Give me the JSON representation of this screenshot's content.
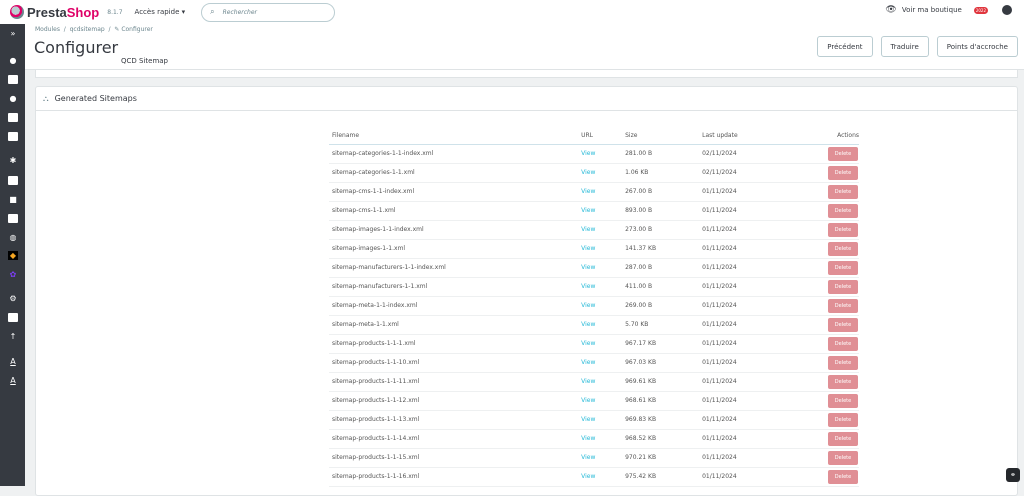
{
  "topbar": {
    "brand_a": "Presta",
    "brand_b": "Shop",
    "version": "8.1.7",
    "quick_access": "Accès rapide ▾",
    "search_placeholder": "Rechercher",
    "view_shop": "Voir ma boutique",
    "notif_badge": "2022"
  },
  "breadcrumb": {
    "items": [
      "Modules",
      "qcdsitemap",
      "Configurer"
    ]
  },
  "header": {
    "title": "Configurer",
    "subtitle": "QCD Sitemap",
    "buttons": [
      "Précédent",
      "Traduire",
      "Points d'accroche"
    ]
  },
  "card": {
    "title": "Generated Sitemaps"
  },
  "table": {
    "headers": [
      "Filename",
      "URL",
      "Size",
      "Last update",
      "Actions"
    ],
    "view_label": "View",
    "delete_label": "Delete",
    "rows": [
      [
        "sitemap-categories-1-1-index.xml",
        "281.00 B",
        "02/11/2024"
      ],
      [
        "sitemap-categories-1-1.xml",
        "1.06 KB",
        "02/11/2024"
      ],
      [
        "sitemap-cms-1-1-index.xml",
        "267.00 B",
        "01/11/2024"
      ],
      [
        "sitemap-cms-1-1.xml",
        "893.00 B",
        "01/11/2024"
      ],
      [
        "sitemap-images-1-1-index.xml",
        "273.00 B",
        "01/11/2024"
      ],
      [
        "sitemap-images-1-1.xml",
        "141.37 KB",
        "01/11/2024"
      ],
      [
        "sitemap-manufacturers-1-1-index.xml",
        "287.00 B",
        "01/11/2024"
      ],
      [
        "sitemap-manufacturers-1-1.xml",
        "411.00 B",
        "01/11/2024"
      ],
      [
        "sitemap-meta-1-1-index.xml",
        "269.00 B",
        "01/11/2024"
      ],
      [
        "sitemap-meta-1-1.xml",
        "5.70 KB",
        "01/11/2024"
      ],
      [
        "sitemap-products-1-1-1.xml",
        "967.17 KB",
        "01/11/2024"
      ],
      [
        "sitemap-products-1-1-10.xml",
        "967.03 KB",
        "01/11/2024"
      ],
      [
        "sitemap-products-1-1-11.xml",
        "969.61 KB",
        "01/11/2024"
      ],
      [
        "sitemap-products-1-1-12.xml",
        "968.61 KB",
        "01/11/2024"
      ],
      [
        "sitemap-products-1-1-13.xml",
        "969.83 KB",
        "01/11/2024"
      ],
      [
        "sitemap-products-1-1-14.xml",
        "968.52 KB",
        "01/11/2024"
      ],
      [
        "sitemap-products-1-1-15.xml",
        "970.21 KB",
        "01/11/2024"
      ],
      [
        "sitemap-products-1-1-16.xml",
        "975.42 KB",
        "01/11/2024"
      ]
    ]
  }
}
